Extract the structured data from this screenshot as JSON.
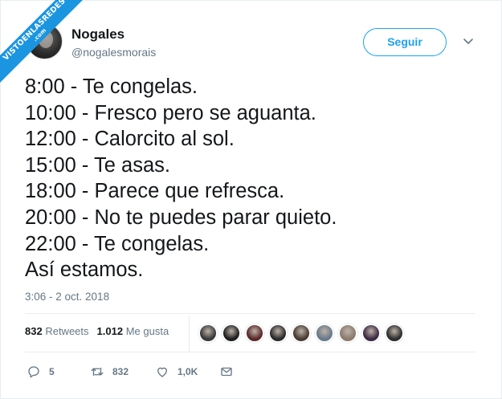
{
  "watermark": {
    "text": "VISTOENLASREDES",
    "suffix": ".com"
  },
  "author": {
    "name": "Nogales",
    "handle": "@nogalesmorais"
  },
  "follow_label": "Seguir",
  "tweet_lines": [
    "8:00 - Te congelas.",
    "10:00 - Fresco pero se aguanta.",
    "12:00 - Calorcito al sol.",
    "15:00 - Te asas.",
    "18:00 - Parece que refresca.",
    "20:00 - No te puedes parar quieto.",
    "22:00 - Te congelas.",
    "Así estamos."
  ],
  "timestamp": "3:06 - 2 oct. 2018",
  "stats": {
    "retweets_count": "832",
    "retweets_label": "Retweets",
    "likes_count": "1.012",
    "likes_label": "Me gusta"
  },
  "likers_avatar_colors": [
    "#3a3a3a",
    "#1f1f1f",
    "#5a2a2a",
    "#2b2b2b",
    "#4a3b33",
    "#6b7a8a",
    "#8c7b6e",
    "#3d2a44",
    "#2e2e2e"
  ],
  "actions": {
    "reply_count": "5",
    "retweet_count": "832",
    "like_count": "1,0K"
  },
  "colors": {
    "accent": "#1da1f2",
    "secondary_text": "#657786",
    "ribbon": "#1b95e0"
  }
}
